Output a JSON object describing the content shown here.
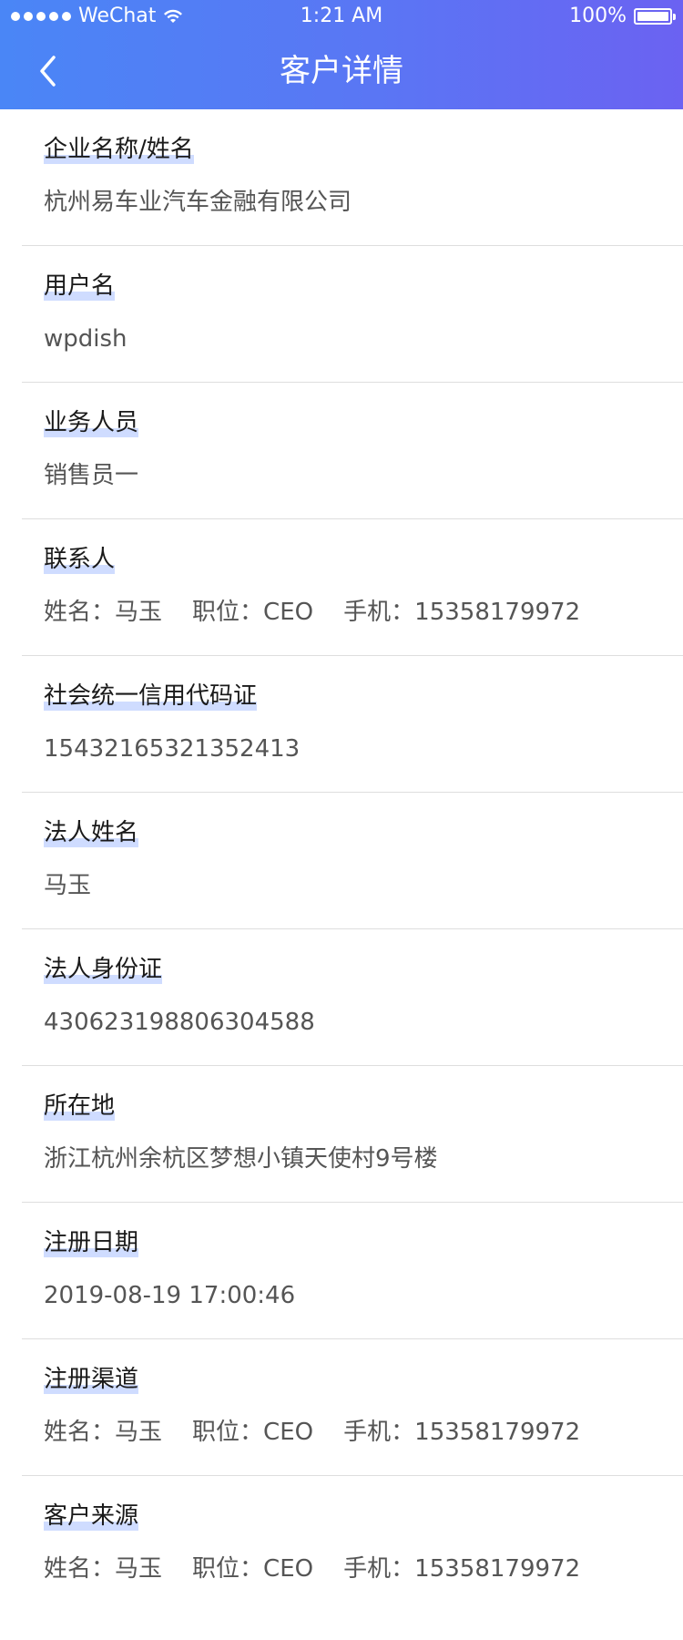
{
  "status_bar": {
    "carrier": "WeChat",
    "time": "1:21 AM",
    "battery_percent_label": "100%",
    "battery_level": 1.0
  },
  "nav": {
    "title": "客户详情",
    "back_icon": "chevron-left-icon"
  },
  "colors": {
    "header_gradient_start": "#4a86f6",
    "header_gradient_end": "#6b62f2",
    "label_highlight": "#cfdcff",
    "divider": "#dedede"
  },
  "fields": [
    {
      "label": "企业名称/姓名",
      "value": "杭州易车业汽车金融有限公司"
    },
    {
      "label": "用户名",
      "value": "wpdish"
    },
    {
      "label": "业务人员",
      "value": "销售员一"
    },
    {
      "label": "联系人",
      "value": "姓名：马玉    职位：CEO    手机：15358179972"
    },
    {
      "label": "社会统一信用代码证",
      "value": "15432165321352413"
    },
    {
      "label": "法人姓名",
      "value": "马玉"
    },
    {
      "label": "法人身份证",
      "value": "430623198806304588"
    },
    {
      "label": "所在地",
      "value": "浙江杭州余杭区梦想小镇天使村9号楼"
    },
    {
      "label": "注册日期",
      "value": "2019-08-19 17:00:46"
    },
    {
      "label": "注册渠道",
      "value": "姓名：马玉    职位：CEO    手机：15358179972"
    },
    {
      "label": "客户来源",
      "value": "姓名：马玉    职位：CEO    手机：15358179972"
    }
  ]
}
